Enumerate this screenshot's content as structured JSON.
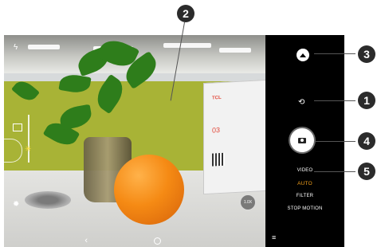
{
  "preview": {
    "calendar_brand": "TCL",
    "calendar_day": "03",
    "zoom_level": "1.0X",
    "flash_icon": "flash-off-icon",
    "settings_icon": "gear-icon"
  },
  "controls": {
    "gallery_icon": "gallery-icon",
    "switch_camera_icon": "switch-camera-icon",
    "shutter_icon": "camera-icon",
    "modes": [
      "VIDEO",
      "AUTO",
      "FILTER",
      "STOP MOTION"
    ],
    "active_mode": "AUTO",
    "active_color": "#f2a01c"
  },
  "annotations": [
    "1",
    "2",
    "3",
    "4",
    "5"
  ]
}
